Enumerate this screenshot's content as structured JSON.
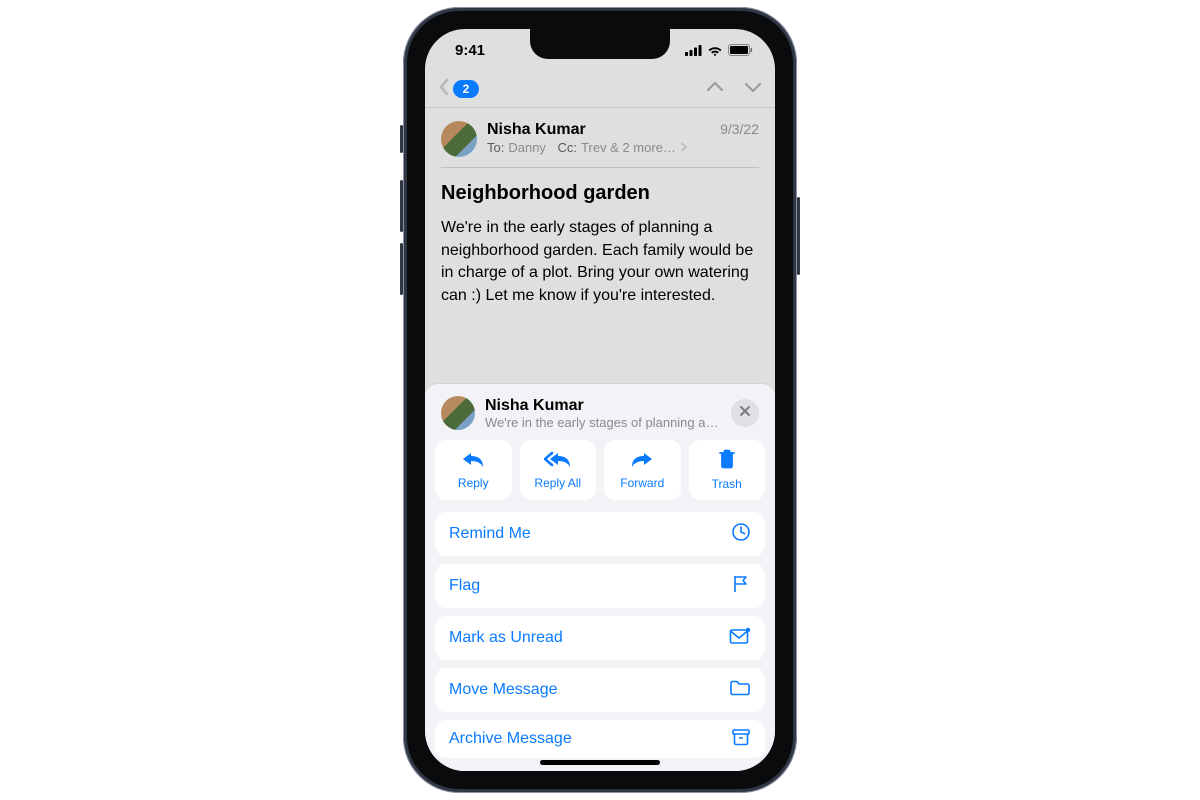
{
  "statusbar": {
    "time": "9:41"
  },
  "navbar": {
    "unread_badge": "2"
  },
  "email": {
    "sender": "Nisha Kumar",
    "date": "9/3/22",
    "to_label": "To:",
    "to_value": "Danny",
    "cc_label": "Cc:",
    "cc_value": "Trev & 2 more…",
    "subject": "Neighborhood garden",
    "body": "We're in the early stages of planning a neighborhood garden. Each family would be in charge of a plot. Bring your own watering can :) Let me know if you're interested."
  },
  "sheet": {
    "name": "Nisha Kumar",
    "preview": "We're in the early stages of planning a n…",
    "actions": {
      "reply": "Reply",
      "reply_all": "Reply All",
      "forward": "Forward",
      "trash": "Trash"
    },
    "list": {
      "remind": "Remind Me",
      "flag": "Flag",
      "mark_unread": "Mark as Unread",
      "move": "Move Message",
      "archive": "Archive Message"
    }
  },
  "colors": {
    "accent": "#0a7aff"
  }
}
